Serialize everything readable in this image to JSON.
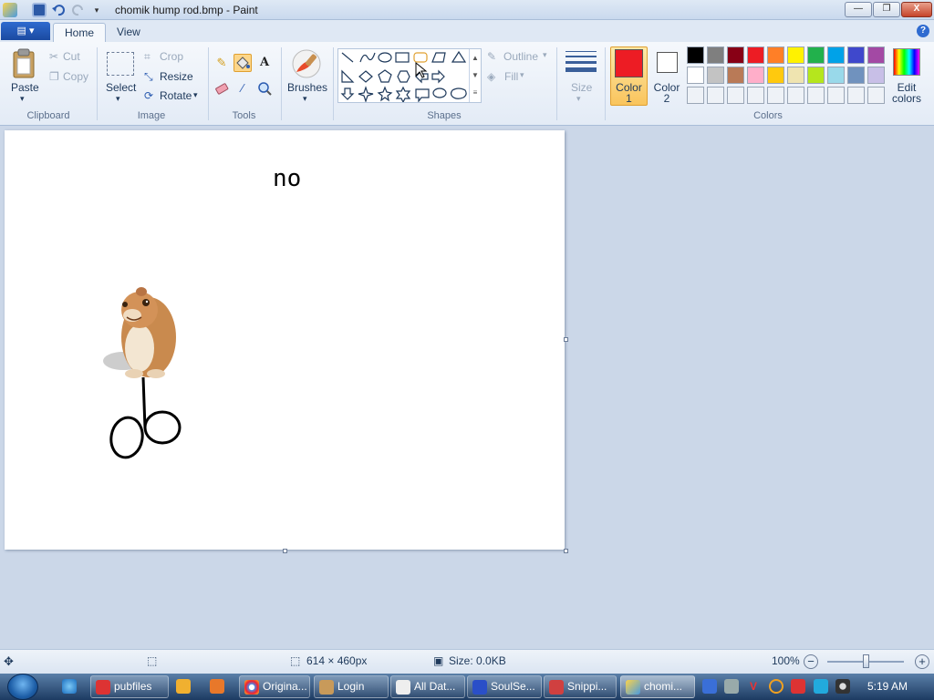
{
  "window": {
    "title": "chomik hump rod.bmp - Paint",
    "minimize": "—",
    "maximize": "❐",
    "close": "X"
  },
  "tabs": {
    "home": "Home",
    "view": "View"
  },
  "help": "?",
  "ribbon": {
    "clipboard": {
      "group": "Clipboard",
      "paste": "Paste",
      "cut": "Cut",
      "copy": "Copy"
    },
    "image": {
      "group": "Image",
      "select": "Select",
      "crop": "Crop",
      "resize": "Resize",
      "rotate": "Rotate"
    },
    "tools": {
      "group": "Tools",
      "text_glyph": "A"
    },
    "brushes": {
      "label": "Brushes"
    },
    "shapes": {
      "group": "Shapes",
      "outline": "Outline",
      "fill": "Fill"
    },
    "size": {
      "label": "Size"
    },
    "colors": {
      "group": "Colors",
      "color1_line1": "Color",
      "color1_line2": "1",
      "color2_line1": "Color",
      "color2_line2": "2",
      "edit_line1": "Edit",
      "edit_line2": "colors",
      "color1": "#ed1c24",
      "color2": "#ffffff",
      "palette": [
        [
          "#000000",
          "#7f7f7f",
          "#880015",
          "#ed1c24",
          "#ff7f27",
          "#fff200",
          "#22b14c",
          "#00a2e8",
          "#3f48cc",
          "#a349a4"
        ],
        [
          "#ffffff",
          "#c3c3c3",
          "#b97a57",
          "#ffaec9",
          "#ffc90e",
          "#efe4b0",
          "#b5e61d",
          "#99d9ea",
          "#7092be",
          "#c8bfe7"
        ],
        [
          "#eef2f7",
          "#eef2f7",
          "#eef2f7",
          "#eef2f7",
          "#eef2f7",
          "#eef2f7",
          "#eef2f7",
          "#eef2f7",
          "#eef2f7",
          "#eef2f7"
        ]
      ]
    }
  },
  "canvas": {
    "text_line1": "",
    "text_line2": "no"
  },
  "status": {
    "dimensions": "614 × 460px",
    "size": "Size: 0.0KB",
    "zoom": "100%"
  },
  "taskbar": {
    "items": [
      "pubfiles",
      "Origina...",
      "Login",
      "All Dat...",
      "SoulSe...",
      "Snippi...",
      "chomi..."
    ],
    "clock": "5:19 AM"
  },
  "colors": {
    "accent": "#1e395b",
    "selected_tab": "#f5f8fc"
  }
}
